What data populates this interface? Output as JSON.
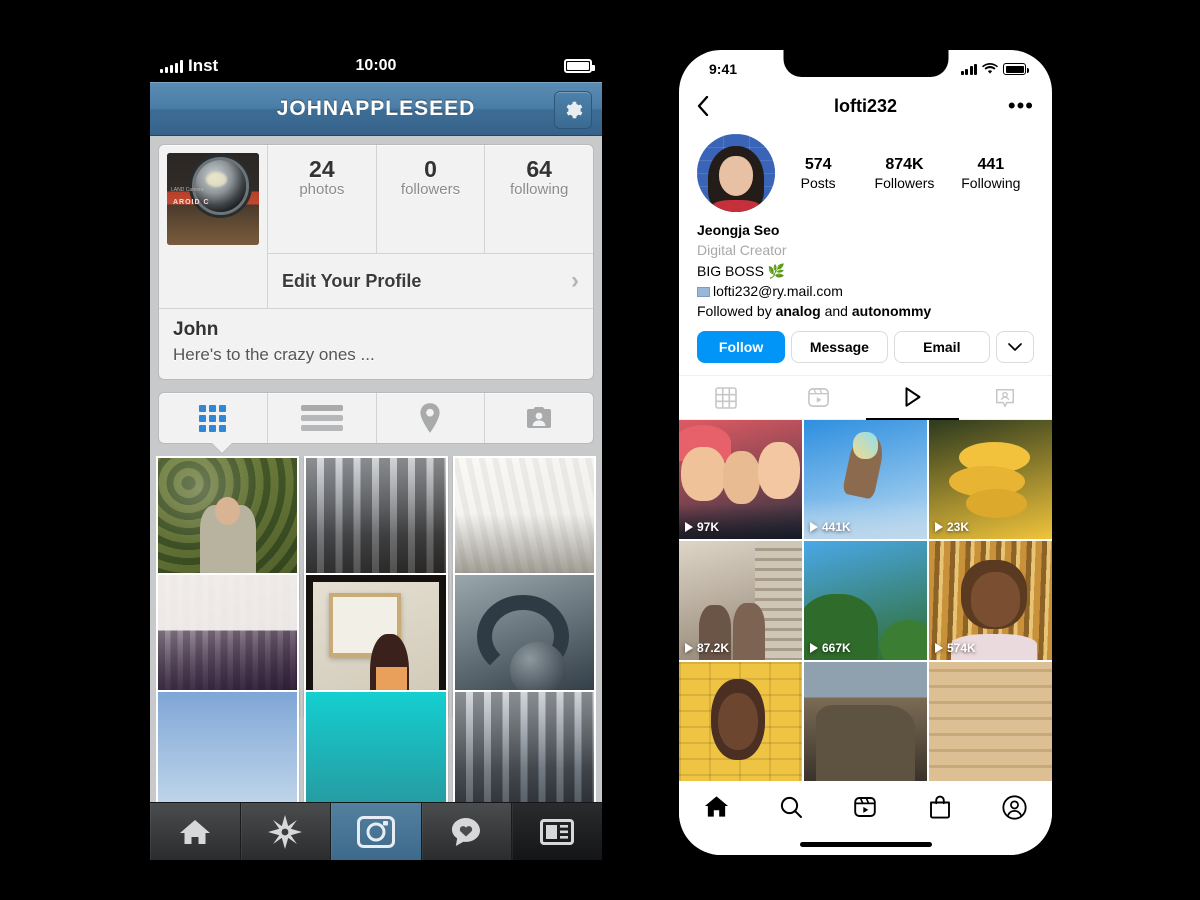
{
  "left_phone": {
    "status_bar": {
      "carrier": "Inst",
      "time": "10:00"
    },
    "nav": {
      "title": "JOHNAPPLESEED",
      "settings_icon": "gear-icon"
    },
    "profile": {
      "avatar_label": "POLAROID COLORPACK",
      "avatar_brand": "AROID C",
      "avatar_small_text": "LAND\nCamera",
      "stats": [
        {
          "value": "24",
          "label": "photos"
        },
        {
          "value": "0",
          "label": "followers"
        },
        {
          "value": "64",
          "label": "following"
        }
      ],
      "edit_row": {
        "label": "Edit Your Profile",
        "chevron": "chevron-right-icon"
      },
      "name": "John",
      "bio": "Here's to the crazy ones ..."
    },
    "segments": [
      {
        "name": "grid-view",
        "icon": "grid-icon",
        "active": true
      },
      {
        "name": "list-view",
        "icon": "list-icon",
        "active": false
      },
      {
        "name": "map-view",
        "icon": "location-pin-icon",
        "active": false
      },
      {
        "name": "tagged-view",
        "icon": "photo-of-you-icon",
        "active": false
      }
    ],
    "photos": [
      {
        "alt": "man-lying-in-ivy",
        "c1": "#6d7c3f",
        "c2": "#3f4a22",
        "kind": "ivy"
      },
      {
        "alt": "city-street-skyscrapers",
        "c1": "#9aa2ae",
        "c2": "#4b4741",
        "kind": "street"
      },
      {
        "alt": "looking-up-at-buildings",
        "c1": "#efeadf",
        "c2": "#b8b3a6",
        "kind": "up"
      },
      {
        "alt": "nyc-skyline-purple",
        "c1": "#e8e6e4",
        "c2": "#3b2340",
        "kind": "skyline"
      },
      {
        "alt": "woman-viewing-art-in-gallery",
        "c1": "#e6e1d4",
        "c2": "#cfc7b5",
        "kind": "gallery"
      },
      {
        "alt": "headphones-closeup",
        "c1": "#9aa8ad",
        "c2": "#25303a",
        "kind": "headphones"
      },
      {
        "alt": "tree-and-sky",
        "c1": "#8b2f3a",
        "c2": "#7fa6d6",
        "kind": "tree"
      },
      {
        "alt": "teal-gradient-sky",
        "c1": "#18c6c6",
        "c2": "#2a8f97",
        "kind": "teal"
      },
      {
        "alt": "apartment-towers",
        "c1": "#9aa3ae",
        "c2": "#55606c",
        "kind": "towers"
      }
    ],
    "tabbar": [
      {
        "name": "home-tab",
        "icon": "home-icon",
        "active": false
      },
      {
        "name": "explore-tab",
        "icon": "star-burst-icon",
        "active": false
      },
      {
        "name": "camera-tab",
        "icon": "camera-icon",
        "active": true
      },
      {
        "name": "activity-tab",
        "icon": "heart-speech-bubble-icon",
        "active": false
      },
      {
        "name": "news-tab",
        "icon": "news-feed-icon",
        "active": false
      }
    ]
  },
  "right_phone": {
    "status_bar": {
      "time": "9:41"
    },
    "nav": {
      "back_icon": "chevron-left-icon",
      "title": "lofti232",
      "more_icon": "ellipsis-icon"
    },
    "profile": {
      "avatar_name": "profile-avatar",
      "stats": [
        {
          "value": "574",
          "label": "Posts"
        },
        {
          "value": "874K",
          "label": "Followers"
        },
        {
          "value": "441",
          "label": "Following"
        }
      ],
      "full_name": "Jeongja Seo",
      "category": "Digital Creator",
      "bio_line": "BIG BOSS 🌿",
      "email": "lofti232@ry.mail.com",
      "followed_by_prefix": "Followed by ",
      "followed_by_1": "analog",
      "followed_by_mid": " and ",
      "followed_by_2": "autonommy"
    },
    "buttons": {
      "follow": "Follow",
      "message": "Message",
      "email": "Email",
      "more_icon": "chevron-down-icon"
    },
    "tabs": [
      {
        "name": "tab-grid",
        "icon": "grid-icon",
        "active": false
      },
      {
        "name": "tab-reels",
        "icon": "reels-icon",
        "active": false
      },
      {
        "name": "tab-igtv",
        "icon": "play-triangle-icon",
        "active": true
      },
      {
        "name": "tab-tagged",
        "icon": "tagged-person-icon",
        "active": false
      }
    ],
    "reels": [
      {
        "views": "97K",
        "alt": "three-friends-selfie",
        "c1": "#e05a63",
        "c2": "#2d3340",
        "kind": "selfie"
      },
      {
        "views": "441K",
        "alt": "glittered-hand-against-sky",
        "c1": "#2e8fe0",
        "c2": "#bcdcf2",
        "kind": "sky-hand"
      },
      {
        "views": "23K",
        "alt": "yellow-mushrooms",
        "c1": "#2d3a1e",
        "c2": "#f0c33a",
        "kind": "mushroom"
      },
      {
        "views": "87.2K",
        "alt": "couple-with-headphones-indoors",
        "c1": "#ded5c8",
        "c2": "#8d7f6e",
        "kind": "indoor"
      },
      {
        "views": "667K",
        "alt": "tree-tops-blue-sky",
        "c1": "#4aa8e8",
        "c2": "#2f6b2a",
        "kind": "trees"
      },
      {
        "views": "574K",
        "alt": "woman-with-gold-tinsel-backdrop",
        "c1": "#c9913a",
        "c2": "#6b4a22",
        "kind": "tinsel"
      },
      {
        "views": "",
        "alt": "woman-yellow-brick-wall",
        "c1": "#f2c84b",
        "c2": "#d8a62c",
        "kind": "yellowwall"
      },
      {
        "views": "",
        "alt": "desert-rock-landscape",
        "c1": "#6f6252",
        "c2": "#2b2a28",
        "kind": "rock"
      },
      {
        "views": "",
        "alt": "carved-stone-relief",
        "c1": "#e0c49a",
        "c2": "#bd9c6d",
        "kind": "stone"
      }
    ],
    "tabbar": [
      {
        "name": "home-tab",
        "icon": "home-icon",
        "active": true
      },
      {
        "name": "search-tab",
        "icon": "search-icon",
        "active": false
      },
      {
        "name": "reels-tab",
        "icon": "reels-icon",
        "active": false
      },
      {
        "name": "shop-tab",
        "icon": "shopping-bag-icon",
        "active": false
      },
      {
        "name": "profile-tab",
        "icon": "person-circle-icon",
        "active": false
      }
    ]
  },
  "colors": {
    "old_nav_blue": "#4a7da6",
    "old_grid_blue": "#2f87d8",
    "instagram_blue": "#0095f6",
    "background": "#000000"
  }
}
